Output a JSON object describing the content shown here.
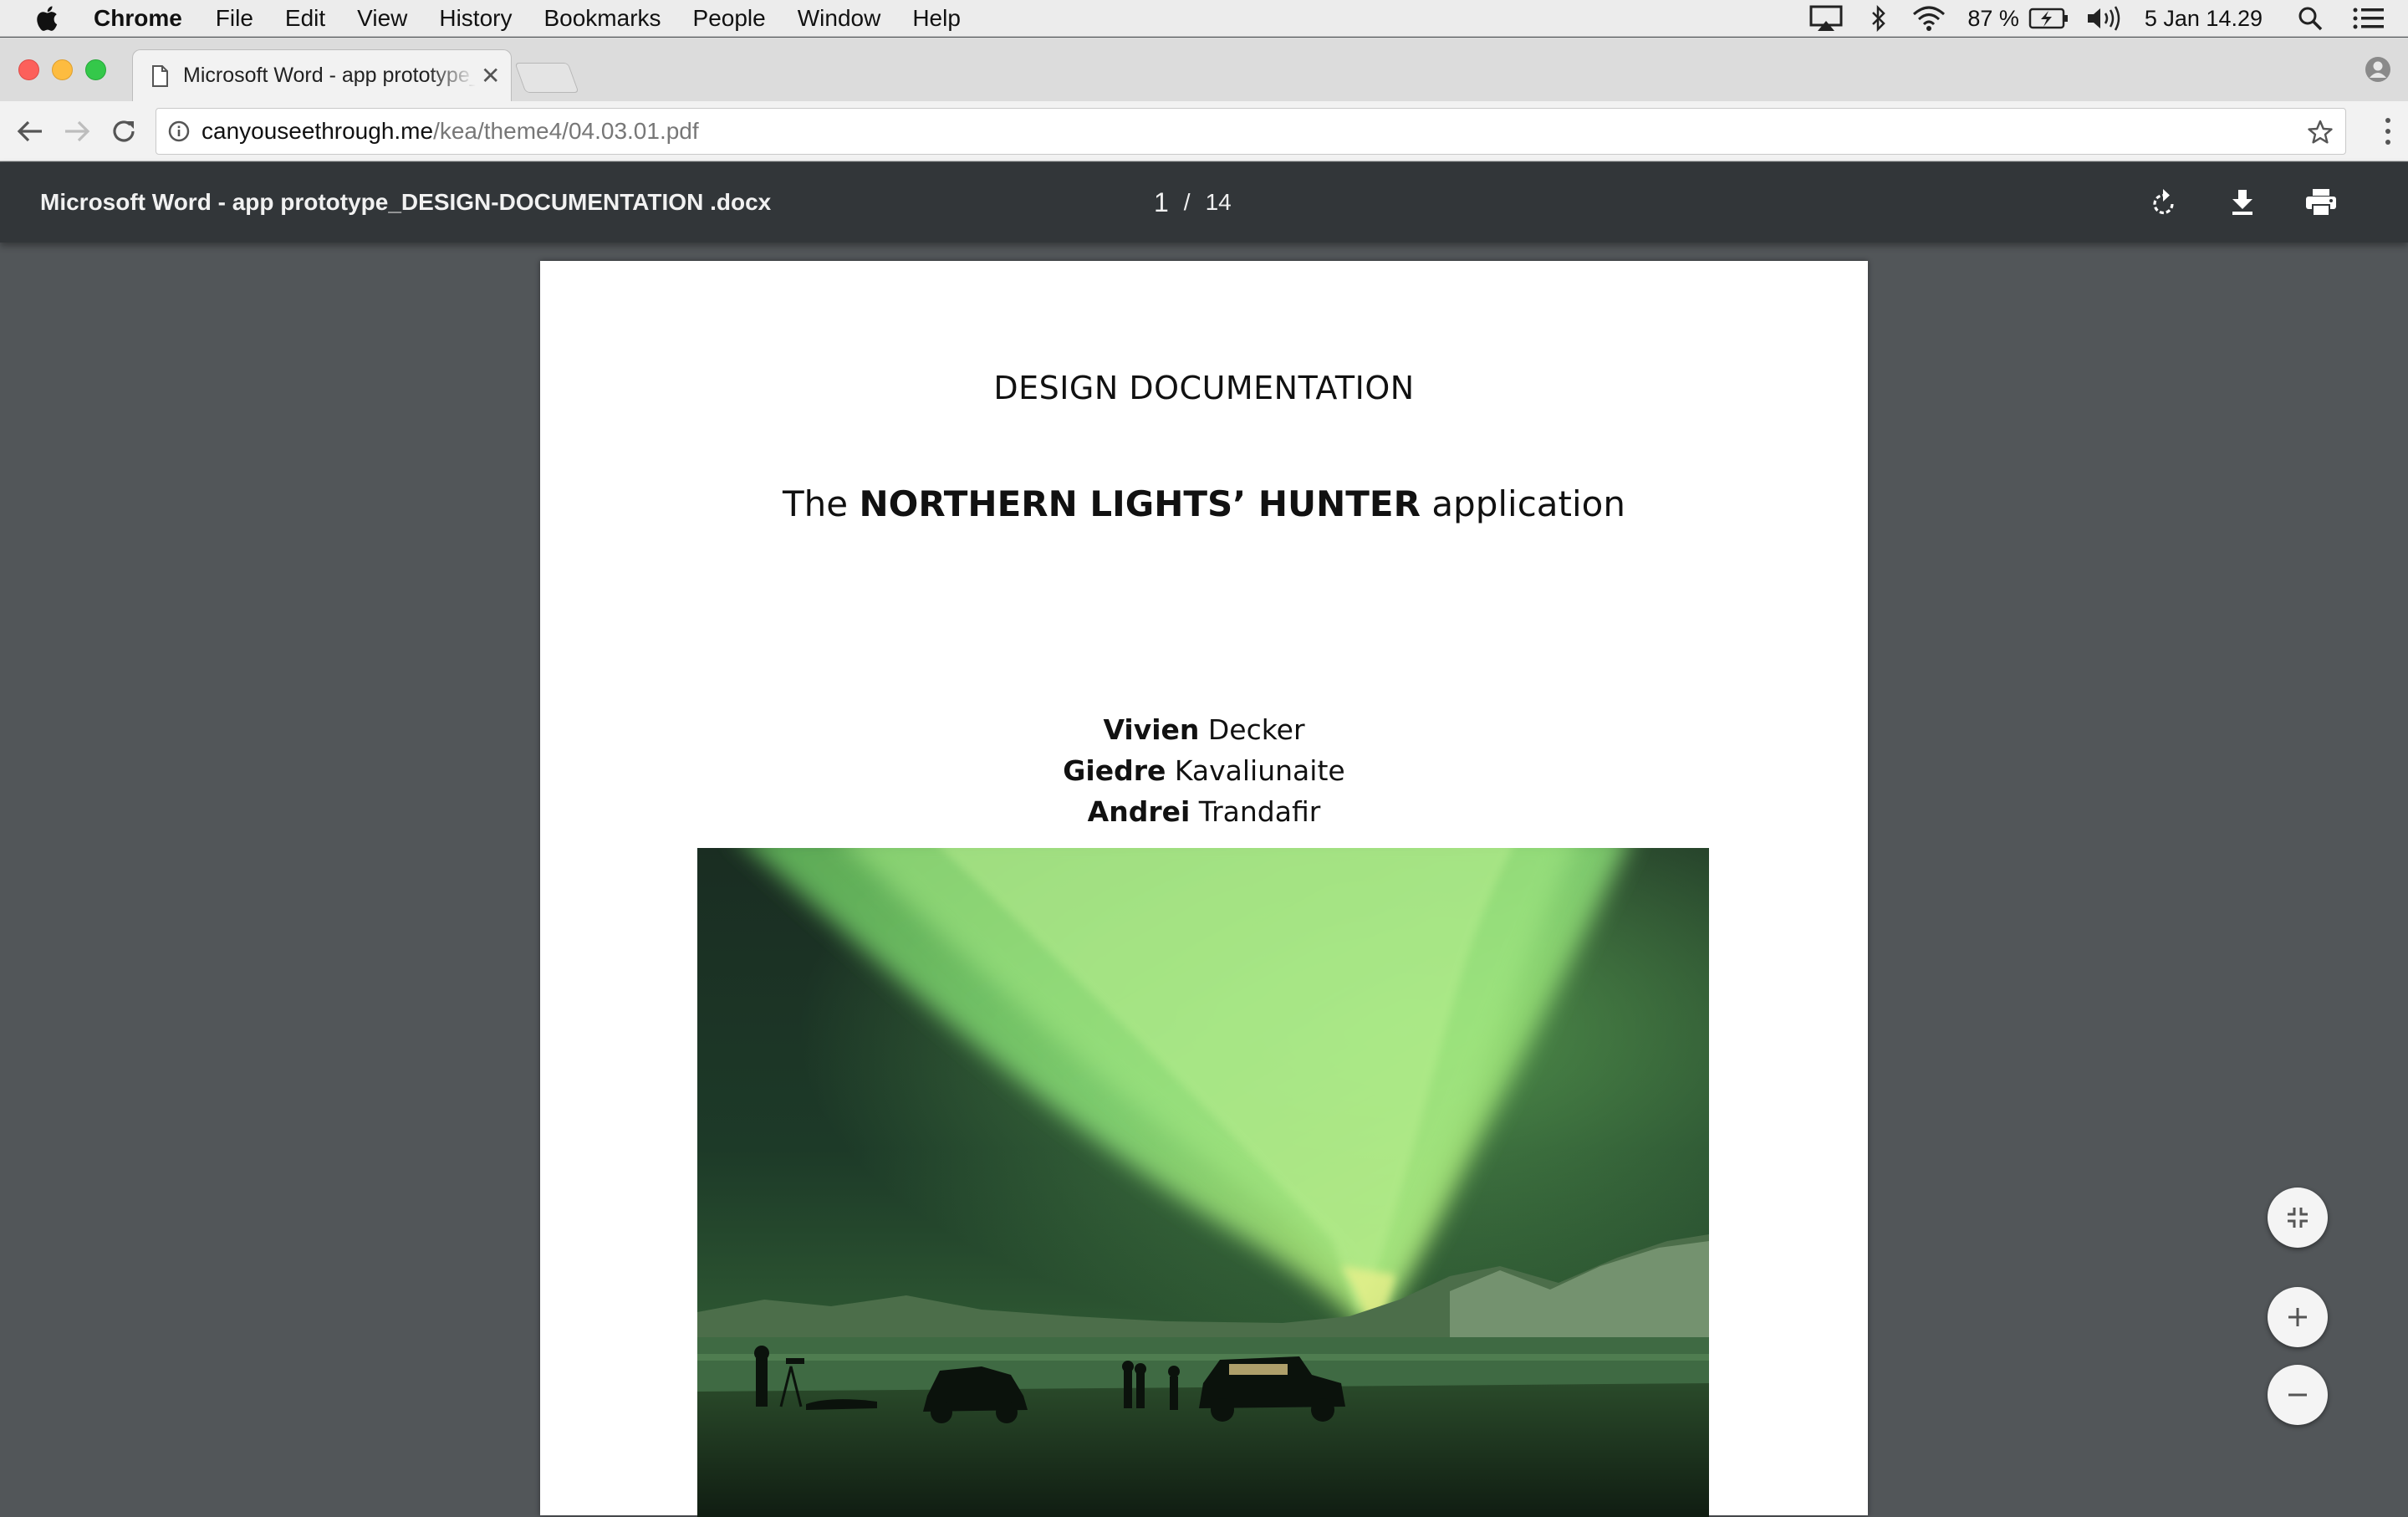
{
  "menubar": {
    "app_name": "Chrome",
    "items": [
      "File",
      "Edit",
      "View",
      "History",
      "Bookmarks",
      "People",
      "Window",
      "Help"
    ],
    "battery": "87 %",
    "clock": "5 Jan  14.29"
  },
  "tab": {
    "title": "Microsoft Word - app prototype_DESIGN-DOCUMENTATION .docx"
  },
  "omnibox": {
    "host": "canyouseethrough.me",
    "path": "/kea/theme4/04.03.01.pdf"
  },
  "pdf_toolbar": {
    "title": "Microsoft Word - app prototype_DESIGN-DOCUMENTATION .docx",
    "current_page": "1",
    "separator": "/",
    "total_pages": "14"
  },
  "document": {
    "heading": "DESIGN DOCUMENTATION",
    "subtitle_prefix": "The ",
    "subtitle_bold": "NORTHERN LIGHTS’ HUNTER",
    "subtitle_suffix": " application",
    "authors": [
      {
        "first": "Vivien",
        "last": " Decker"
      },
      {
        "first": "Giedre",
        "last": " Kavaliunaite"
      },
      {
        "first": "Andrei",
        "last": " Trandafir"
      }
    ]
  },
  "colors": {
    "pdf_toolbar_bg": "#323639",
    "viewer_bg": "#525659",
    "aurora_green": "#7fe07a"
  },
  "icons": [
    "apple-icon",
    "airplay-icon",
    "bluetooth-icon",
    "wifi-icon",
    "battery-icon",
    "volume-icon",
    "spotlight-icon",
    "notification-center-icon",
    "document-icon",
    "close-icon",
    "profile-icon",
    "back-icon",
    "forward-icon",
    "reload-icon",
    "info-icon",
    "star-icon",
    "menu-icon",
    "rotate-icon",
    "download-icon",
    "print-icon",
    "fit-page-icon",
    "zoom-in-icon",
    "zoom-out-icon"
  ]
}
